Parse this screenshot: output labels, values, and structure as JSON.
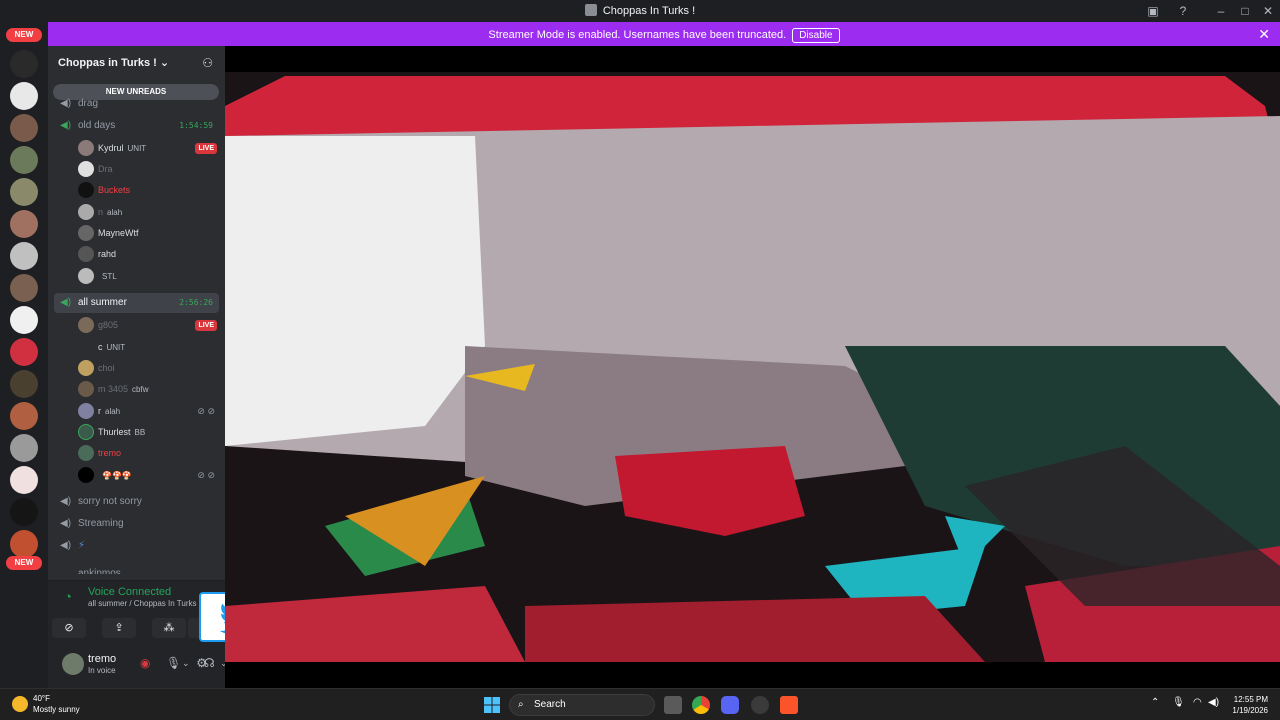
{
  "window": {
    "title": "Choppas In Turks !"
  },
  "banner": {
    "message": "Streamer Mode is enabled. Usernames have been truncated.",
    "disable_label": "Disable"
  },
  "guild_rail": {
    "new_badge_top": "NEW",
    "new_badge_bottom": "NEW"
  },
  "server": {
    "name": "Choppas in Turks !",
    "new_unreads": "NEW UNREADS"
  },
  "channels": {
    "drag": "drag",
    "old_days": {
      "name": "old days",
      "timer": "1:54:59"
    },
    "all_summer": {
      "name": "all summer",
      "timer": "2:56:26"
    },
    "sorry": "sorry not sorry",
    "streaming": "Streaming",
    "partial": "ankinmos"
  },
  "old_days_users": [
    {
      "name": "Kydrul",
      "tag": "UNIT",
      "live": "LIVE"
    },
    {
      "name": "Dra"
    },
    {
      "name": "Buckets"
    },
    {
      "name": "n",
      "tag": "alah"
    },
    {
      "name": "MayneWtf"
    },
    {
      "name": "rahd"
    },
    {
      "name": "",
      "tag": "STL"
    }
  ],
  "all_summer_users": [
    {
      "name": "g805",
      "live": "LIVE"
    },
    {
      "name": "c",
      "tag": "UNIT"
    },
    {
      "name": "choi"
    },
    {
      "name": "m 3405",
      "tag": "cbfw"
    },
    {
      "name": "r",
      "tag": "alah"
    },
    {
      "name": "Thurlest",
      "tag": "BB"
    },
    {
      "name": "tremo"
    },
    {
      "name": "",
      "tag": "🍄🍄🍄"
    }
  ],
  "voice": {
    "status": "Voice Connected",
    "location": "all summer / Choppas In Turks !"
  },
  "user": {
    "name": "tremo",
    "status": "In voice"
  },
  "taskbar": {
    "temp": "40°F",
    "weather": "Mostly sunny",
    "search": "Search",
    "time": "12:55 PM",
    "date": "1/19/2026"
  },
  "colors": {
    "accent": "#9b2cf0",
    "live": "#da373c",
    "connected": "#23a55a"
  }
}
